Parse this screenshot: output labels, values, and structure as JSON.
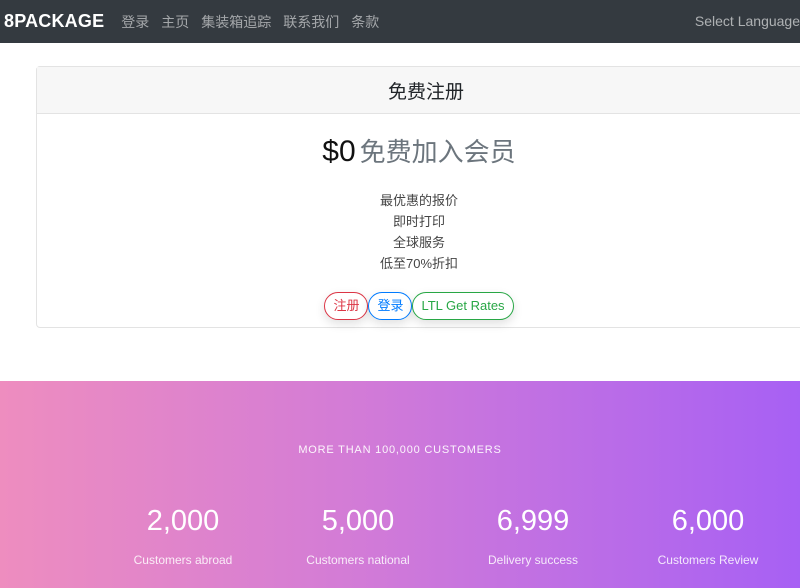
{
  "navbar": {
    "brand": "8PACKAGE",
    "links": [
      "登录",
      "主页",
      "集装箱追踪",
      "联系我们",
      "条款"
    ],
    "language": "Select Language"
  },
  "card": {
    "header": "免费注册",
    "price_amount": "$0",
    "price_text": "免费加入会员",
    "features": [
      "最优惠的报价",
      "即时打印",
      "全球服务",
      "低至70%折扣"
    ],
    "buttons": {
      "register": "注册",
      "login": "登录",
      "ltl": "LTL Get Rates"
    }
  },
  "stats": {
    "heading": "MORE THAN 100,000 CUSTOMERS",
    "items": [
      {
        "value": "2,000",
        "label": "Customers abroad"
      },
      {
        "value": "5,000",
        "label": "Customers national"
      },
      {
        "value": "6,999",
        "label": "Delivery success"
      },
      {
        "value": "6,000",
        "label": "Customers Review"
      }
    ]
  },
  "colors": {
    "navbar": "#343a40",
    "gradient_start": "#ee8dbf",
    "gradient_end": "#a760f4",
    "register": "#dc3545",
    "login": "#007bff",
    "ltl": "#28a745"
  }
}
